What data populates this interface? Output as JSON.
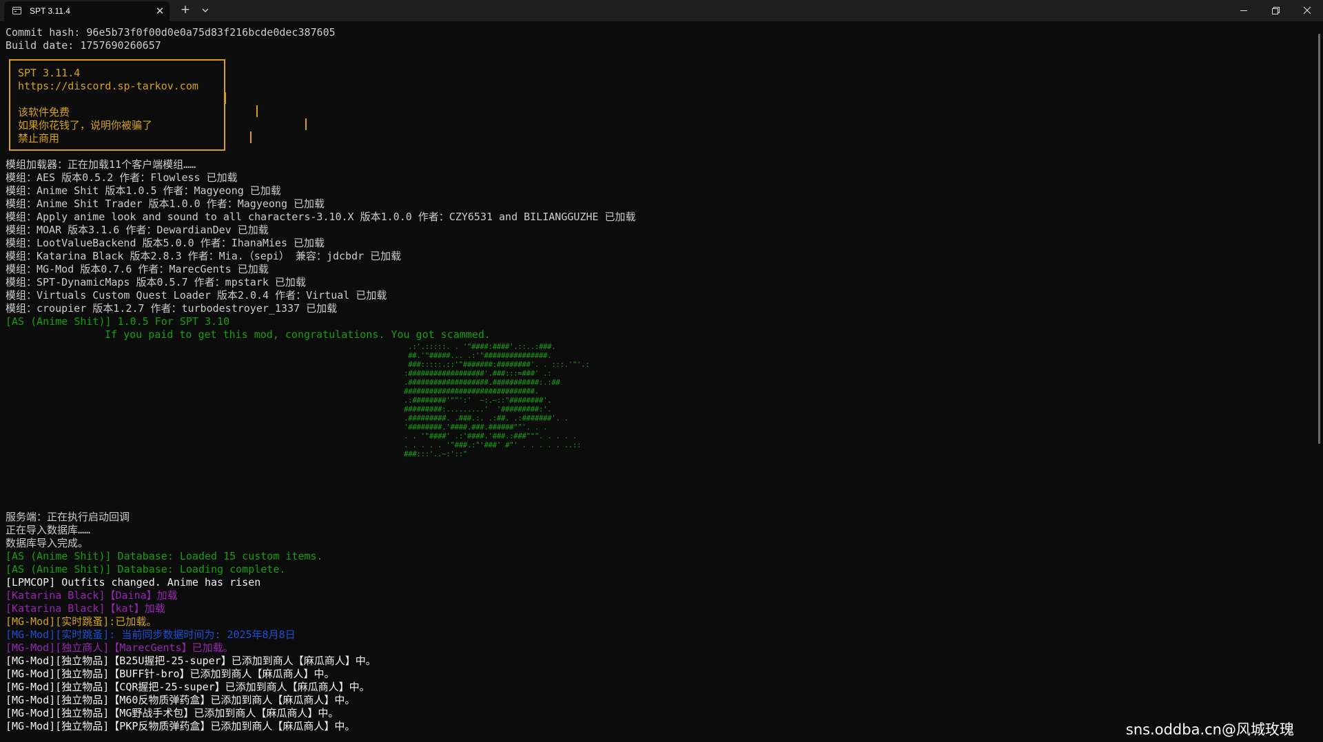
{
  "window": {
    "tab_title": "SPT 3.11.4",
    "tab_close_glyph": "✕",
    "new_tab_glyph": "+",
    "icons": [
      "terminal-icon",
      "close-icon",
      "plus-icon",
      "chevron-down-icon",
      "minimize-icon",
      "restore-icon",
      "close-window-icon"
    ]
  },
  "colors": {
    "background": "#0c0c0c",
    "titlebar": "#1f1f1f",
    "text": "#cccccc",
    "yellow": "#d6a215",
    "green": "#16a10c",
    "magenta": "#9a25b4",
    "blue": "#1a4fd6"
  },
  "header": {
    "commit": "Commit hash: 96e5b73f0f00d0e0a75d83f216bcde0dec387605",
    "build": "Build date: 1757690260657"
  },
  "banner": {
    "version": "SPT 3.11.4",
    "url": "https://discord.sp-tarkov.com",
    "free": "该软件免费",
    "scam": "如果你花钱了，说明你被骗了",
    "no_commercial": "禁止商用"
  },
  "mods": {
    "loading": "模组加载器：正在加载11个客户端模组……",
    "lines": [
      "模组：AES 版本0.5.2 作者：Flowless 已加载",
      "模组：Anime Shit 版本1.0.5 作者：Magyeong 已加载",
      "模组：Anime Shit Trader 版本1.0.0 作者：Magyeong 已加载",
      "模组：Apply anime look and sound to all characters-3.10.X 版本1.0.0 作者：CZY6531 and BILIANGGUZHE 已加载",
      "模组：MOAR 版本3.1.6 作者：DewardianDev 已加载",
      "模组：LootValueBackend 版本5.0.0 作者：IhanaMies 已加载",
      "模组：Katarina Black 版本2.8.3 作者：Mia.（sepi） 兼容：jdcbdr 已加载",
      "模组：MG-Mod 版本0.7.6 作者：MarecGents 已加载",
      "模组：SPT-DynamicMaps 版本0.5.7 作者：mpstark 已加载",
      "模组：Virtuals Custom Quest Loader 版本2.0.4 作者：Virtual 已加载",
      "模组：croupier 版本1.2.7 作者：turbodestroyer_1337 已加载"
    ]
  },
  "anime_shit": {
    "version_line": "[AS (Anime Shit)] 1.0.5 For SPT 3.10",
    "scam_line": "If you paid to get this mod, congratulations. You got scammed.",
    "art_lines": [
      " .:'.:::::. . '\"####:####'.::..:###.",
      " ##.'\"#####... .:'\"###############.",
      " ###:::::.::'\"#######:########'. . :::.'\"'.:",
      ":##################'.###:::=###' .:",
      ".###################.###########:.:##",
      "###############################.",
      ".:########'\"\"':'  ~:.~::\"########'.",
      "#########:.........'  '#########:'.",
      ".#########. .###.:. .:##. .:#######'. .",
      "'########.'####.###.######\"\"'. . .",
      ". . '\"####' .:'####.'###.:###\"\"\". . . . .",
      ". . . . . '\"###.:\"'###' #\"' . . . . . ..::",
      "###:::'..~:'::\""
    ]
  },
  "server": {
    "callbacks": "服务端：正在执行启动回调",
    "importing": "正在导入数据库……",
    "imported": "数据库导入完成。"
  },
  "log": {
    "as_db_loaded": "[AS (Anime Shit)] Database: Loaded 15 custom items.",
    "as_db_complete": "[AS (Anime Shit)] Database: Loading complete.",
    "lpmcop": "[LPMCOP] Outfits changed. Anime has risen",
    "kat_daina": "[Katarina Black]【Daina】加载",
    "kat_kat": "[Katarina Black]【kat】加载",
    "mg_realtime_loaded": "[MG-Mod][实时跳蚤]:已加载。",
    "mg_realtime_sync": "[MG-Mod][实时跳蚤]: 当前同步数据时间为: 2025年8月8日",
    "mg_merchant_loaded": "[MG-Mod][独立商人]【MarecGents】已加载。",
    "items": [
      "[MG-Mod][独立物品]【B25U握把-25-super】已添加到商人【麻瓜商人】中。",
      "[MG-Mod][独立物品]【BUFF针-bro】已添加到商人【麻瓜商人】中。",
      "[MG-Mod][独立物品]【CQR握把-25-super】已添加到商人【麻瓜商人】中。",
      "[MG-Mod][独立物品]【M60反物质弹药盒】已添加到商人【麻瓜商人】中。",
      "[MG-Mod][独立物品]【MG野战手术包】已添加到商人【麻瓜商人】中。",
      "[MG-Mod][独立物品]【PKP反物质弹药盒】已添加到商人【麻瓜商人】中。"
    ]
  },
  "watermark": "sns.oddba.cn@风城玫瑰"
}
